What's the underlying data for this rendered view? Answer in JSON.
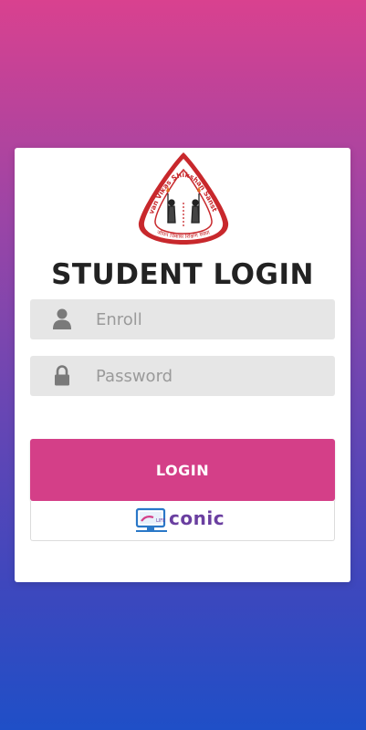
{
  "logo": {
    "top_text": "Jeevan Vikas Shikshan Sansthan",
    "bottom_text": "जीवन विकास शिक्षण संस्था"
  },
  "title": "STUDENT LOGIN",
  "enroll": {
    "placeholder": "Enroll",
    "value": "",
    "icon": "user-icon"
  },
  "password": {
    "placeholder": "Password",
    "value": "",
    "icon": "lock-icon"
  },
  "login_label": "LOGIN",
  "brand": {
    "text": "conic",
    "logo_prefix": "LIFE"
  },
  "colors": {
    "gradient_top": "#d9418f",
    "gradient_bottom": "#1f4fc7",
    "accent": "#d43f88",
    "logo_red": "#c8282c",
    "brand_purple": "#6a3fa0"
  }
}
